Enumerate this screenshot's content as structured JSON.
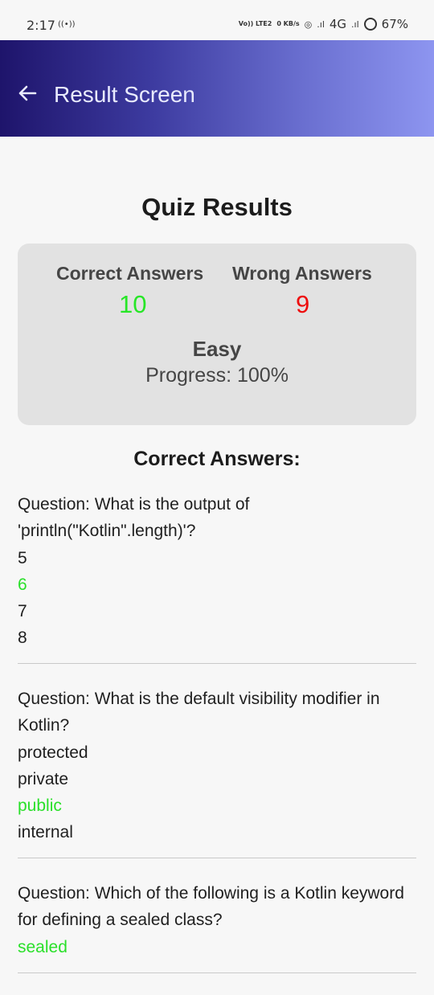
{
  "status_bar": {
    "time": "2:17",
    "radio_icon": "((•))",
    "volte": "Vo)) LTE2",
    "speed": "0 KB/s",
    "network": "4G",
    "battery": "67%"
  },
  "app_bar": {
    "title": "Result Screen",
    "back_icon": "arrow-left-icon"
  },
  "results": {
    "title": "Quiz Results",
    "correct_label": "Correct Answers",
    "correct_value": "10",
    "wrong_label": "Wrong Answers",
    "wrong_value": "9",
    "difficulty": "Easy",
    "progress": "Progress: 100%"
  },
  "correct_section_title": "Correct Answers:",
  "questions": [
    {
      "text": "Question: What is the output of 'println(\"Kotlin\".length)'?",
      "options": [
        "5",
        "6",
        "7",
        "8"
      ],
      "correct_index": 1
    },
    {
      "text": "Question: What is the default visibility modifier in Kotlin?",
      "options": [
        "protected",
        "private",
        "public",
        "internal"
      ],
      "correct_index": 2
    },
    {
      "text": "Question: Which of the following is a Kotlin keyword for defining a sealed class?",
      "options": [
        "sealed"
      ],
      "correct_index": 0
    }
  ],
  "colors": {
    "correct": "#27e627",
    "wrong": "#ee0d0d",
    "app_bar_start": "#1e146b",
    "app_bar_end": "#8d95f0"
  }
}
